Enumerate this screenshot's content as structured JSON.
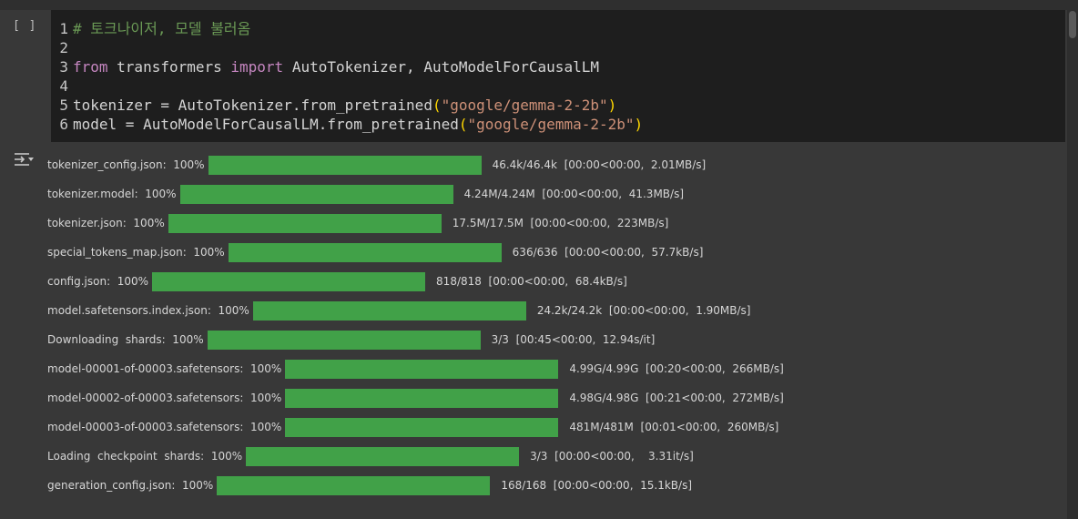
{
  "cell": {
    "run_button_label": "[ ]",
    "code_lines": [
      {
        "num": "1",
        "parts": [
          {
            "cls": "cm",
            "text": "# 토크나이저, 모델 불러옴"
          }
        ]
      },
      {
        "num": "2",
        "parts": []
      },
      {
        "num": "3",
        "parts": [
          {
            "cls": "kw",
            "text": "from"
          },
          {
            "cls": "",
            "text": " transformers "
          },
          {
            "cls": "kw",
            "text": "import"
          },
          {
            "cls": "",
            "text": " AutoTokenizer, AutoModelForCausalLM"
          }
        ]
      },
      {
        "num": "4",
        "parts": []
      },
      {
        "num": "5",
        "parts": [
          {
            "cls": "",
            "text": "tokenizer = AutoTokenizer.from_pretrained"
          },
          {
            "cls": "paren",
            "text": "("
          },
          {
            "cls": "str",
            "text": "\"google/gemma-2-2b\""
          },
          {
            "cls": "paren",
            "text": ")"
          }
        ]
      },
      {
        "num": "6",
        "parts": [
          {
            "cls": "",
            "text": "model = AutoModelForCausalLM.from_pretrained"
          },
          {
            "cls": "paren",
            "text": "("
          },
          {
            "cls": "str",
            "text": "\"google/gemma-2-2b\""
          },
          {
            "cls": "paren",
            "text": ")"
          }
        ]
      }
    ]
  },
  "output": {
    "toggle_icon": "output-toggle-icon",
    "progress_rows": [
      {
        "label": "tokenizer_config.json:  100%",
        "progress": 1.0,
        "stats": "46.4k/46.4k  [00:00<00:00,  2.01MB/s]"
      },
      {
        "label": "tokenizer.model:  100%",
        "progress": 1.0,
        "stats": "4.24M/4.24M  [00:00<00:00,  41.3MB/s]"
      },
      {
        "label": "tokenizer.json:  100%",
        "progress": 1.0,
        "stats": "17.5M/17.5M  [00:00<00:00,  223MB/s]"
      },
      {
        "label": "special_tokens_map.json:  100%",
        "progress": 1.0,
        "stats": "636/636  [00:00<00:00,  57.7kB/s]"
      },
      {
        "label": "config.json:  100%",
        "progress": 1.0,
        "stats": "818/818  [00:00<00:00,  68.4kB/s]"
      },
      {
        "label": "model.safetensors.index.json:  100%",
        "progress": 1.0,
        "stats": "24.2k/24.2k  [00:00<00:00,  1.90MB/s]"
      },
      {
        "label": "Downloading  shards:  100%",
        "progress": 1.0,
        "stats": "3/3  [00:45<00:00,  12.94s/it]"
      },
      {
        "label": "model-00001-of-00003.safetensors:  100%",
        "progress": 1.0,
        "stats": "4.99G/4.99G  [00:20<00:00,  266MB/s]"
      },
      {
        "label": "model-00002-of-00003.safetensors:  100%",
        "progress": 1.0,
        "stats": "4.98G/4.98G  [00:21<00:00,  272MB/s]"
      },
      {
        "label": "model-00003-of-00003.safetensors:  100%",
        "progress": 1.0,
        "stats": "481M/481M  [00:01<00:00,  260MB/s]"
      },
      {
        "label": "Loading  checkpoint  shards:  100%",
        "progress": 1.0,
        "stats": "3/3  [00:00<00:00,    3.31it/s]"
      },
      {
        "label": "generation_config.json:  100%",
        "progress": 1.0,
        "stats": "168/168  [00:00<00:00,  15.1kB/s]"
      }
    ]
  },
  "colors": {
    "bar": "#41a148",
    "comment": "#6a9955",
    "keyword": "#c586c0",
    "string": "#ce9178",
    "paren": "#ffd700"
  }
}
